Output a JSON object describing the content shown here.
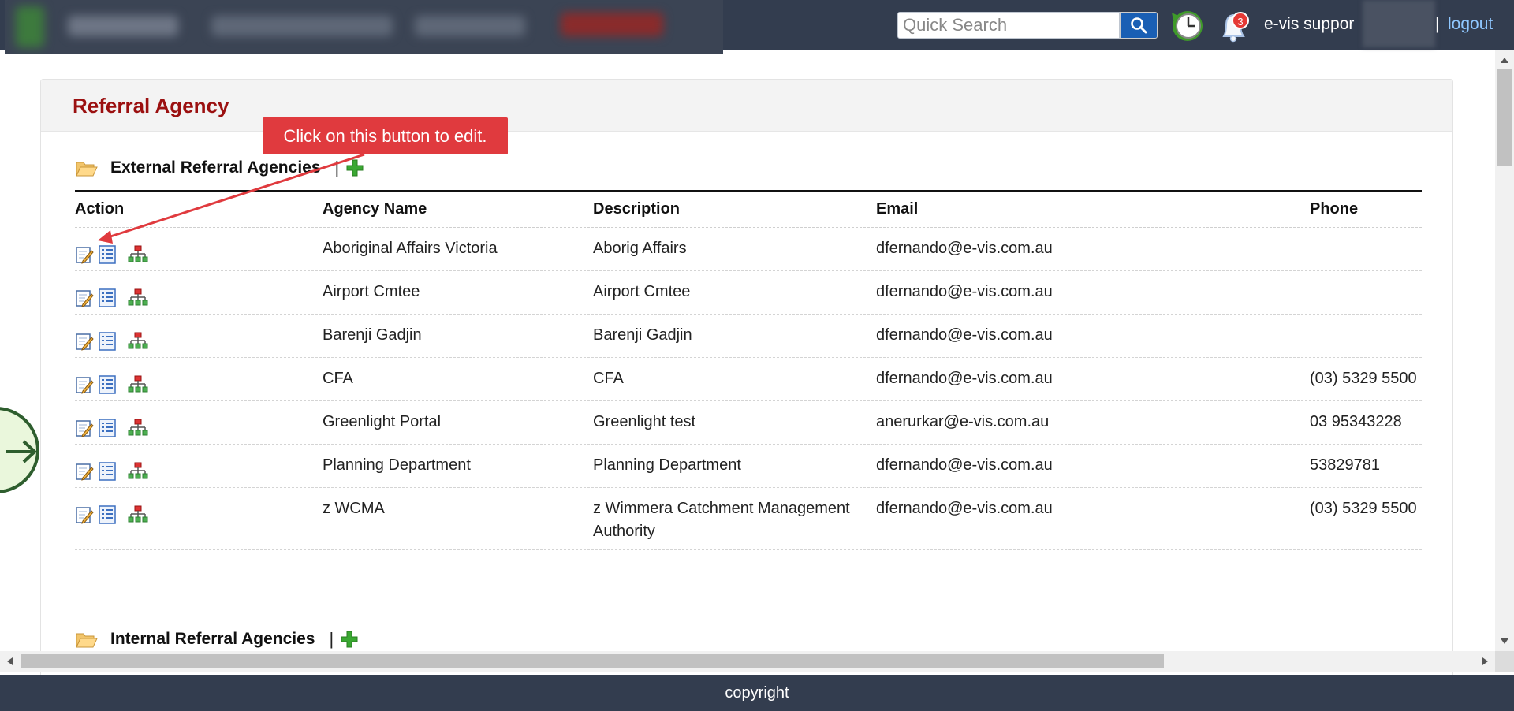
{
  "topbar": {
    "search_placeholder": "Quick Search",
    "notification_count": "3",
    "user_name": "e-vis suppor",
    "separator": "|",
    "logout_label": "logout"
  },
  "page": {
    "title": "Referral Agency"
  },
  "callout": {
    "text": "Click on this button to edit."
  },
  "external": {
    "title": "External Referral Agencies",
    "separator": "|"
  },
  "internal": {
    "title": "Internal Referral Agencies",
    "separator": "|"
  },
  "table": {
    "headers": {
      "action": "Action",
      "name": "Agency Name",
      "description": "Description",
      "email": "Email",
      "phone": "Phone"
    },
    "rows": [
      {
        "name": "Aboriginal Affairs Victoria",
        "description": "Aborig Affairs",
        "email": "dfernando@e-vis.com.au",
        "phone": ""
      },
      {
        "name": "Airport Cmtee",
        "description": "Airport Cmtee",
        "email": "dfernando@e-vis.com.au",
        "phone": ""
      },
      {
        "name": "Barenji Gadjin",
        "description": "Barenji Gadjin",
        "email": "dfernando@e-vis.com.au",
        "phone": ""
      },
      {
        "name": "CFA",
        "description": "CFA",
        "email": "dfernando@e-vis.com.au",
        "phone": "(03) 5329 5500"
      },
      {
        "name": "Greenlight Portal",
        "description": "Greenlight test",
        "email": "anerurkar@e-vis.com.au",
        "phone": "03 95343228"
      },
      {
        "name": "Planning Department",
        "description": "Planning Department",
        "email": "dfernando@e-vis.com.au",
        "phone": "53829781"
      },
      {
        "name": "z WCMA",
        "description": "z Wimmera Catchment Management Authority",
        "email": "dfernando@e-vis.com.au",
        "phone": "(03) 5329 5500"
      }
    ]
  },
  "footer": {
    "text": "copyright"
  },
  "colors": {
    "topbar": "#333d4f",
    "title_red": "#9b1010",
    "callout_red": "#e03a3e",
    "link_blue": "#8fc7ff",
    "plus_green": "#3aa832"
  },
  "icons": {
    "search": "search-icon",
    "clock": "history-clock-icon",
    "bell": "notification-bell-icon",
    "folder": "folder-open-icon",
    "add": "plus-icon",
    "edit": "edit-icon",
    "details": "list-details-icon",
    "hierarchy": "hierarchy-icon"
  }
}
